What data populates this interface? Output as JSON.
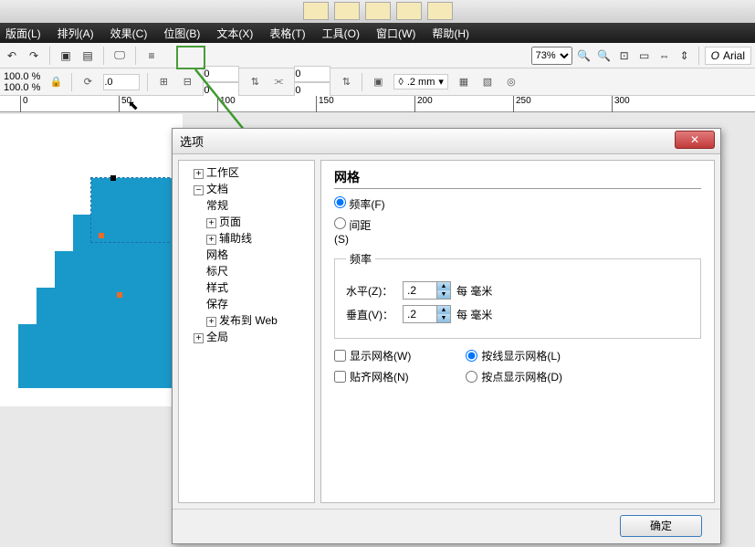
{
  "menu": [
    "版面(L)",
    "排列(A)",
    "效果(C)",
    "位图(B)",
    "文本(X)",
    "表格(T)",
    "工具(O)",
    "窗口(W)",
    "帮助(H)"
  ],
  "tb1": {
    "zoom": "73%",
    "font": "Arial"
  },
  "tb2": {
    "pct1": "100.0",
    "pct2": "100.0",
    "rot": ".0",
    "v0a": "0",
    "v0b": "0",
    "v1a": "0",
    "v1b": "0",
    "outline": ".2 mm"
  },
  "ruler": [
    "0",
    "50",
    "100",
    "150",
    "200",
    "250",
    "300"
  ],
  "dialog": {
    "title": "选项",
    "tree": {
      "workspace": "工作区",
      "doc": "文档",
      "general": "常规",
      "page": "页面",
      "guides": "辅助线",
      "grid": "网格",
      "ruler": "标尺",
      "style": "样式",
      "save": "保存",
      "publish": "发布到 Web",
      "global": "全局"
    },
    "panel": {
      "heading": "网格",
      "freq": "频率(F)",
      "spacing": "间距(S)",
      "freq_legend": "频率",
      "horiz": "水平(Z)：",
      "vert": "垂直(V)：",
      "val_h": ".2",
      "val_v": ".2",
      "unit": "每 毫米",
      "show_grid": "显示网格(W)",
      "snap_grid": "贴齐网格(N)",
      "show_line": "按线显示网格(L)",
      "show_dot": "按点显示网格(D)"
    },
    "ok": "确定"
  }
}
